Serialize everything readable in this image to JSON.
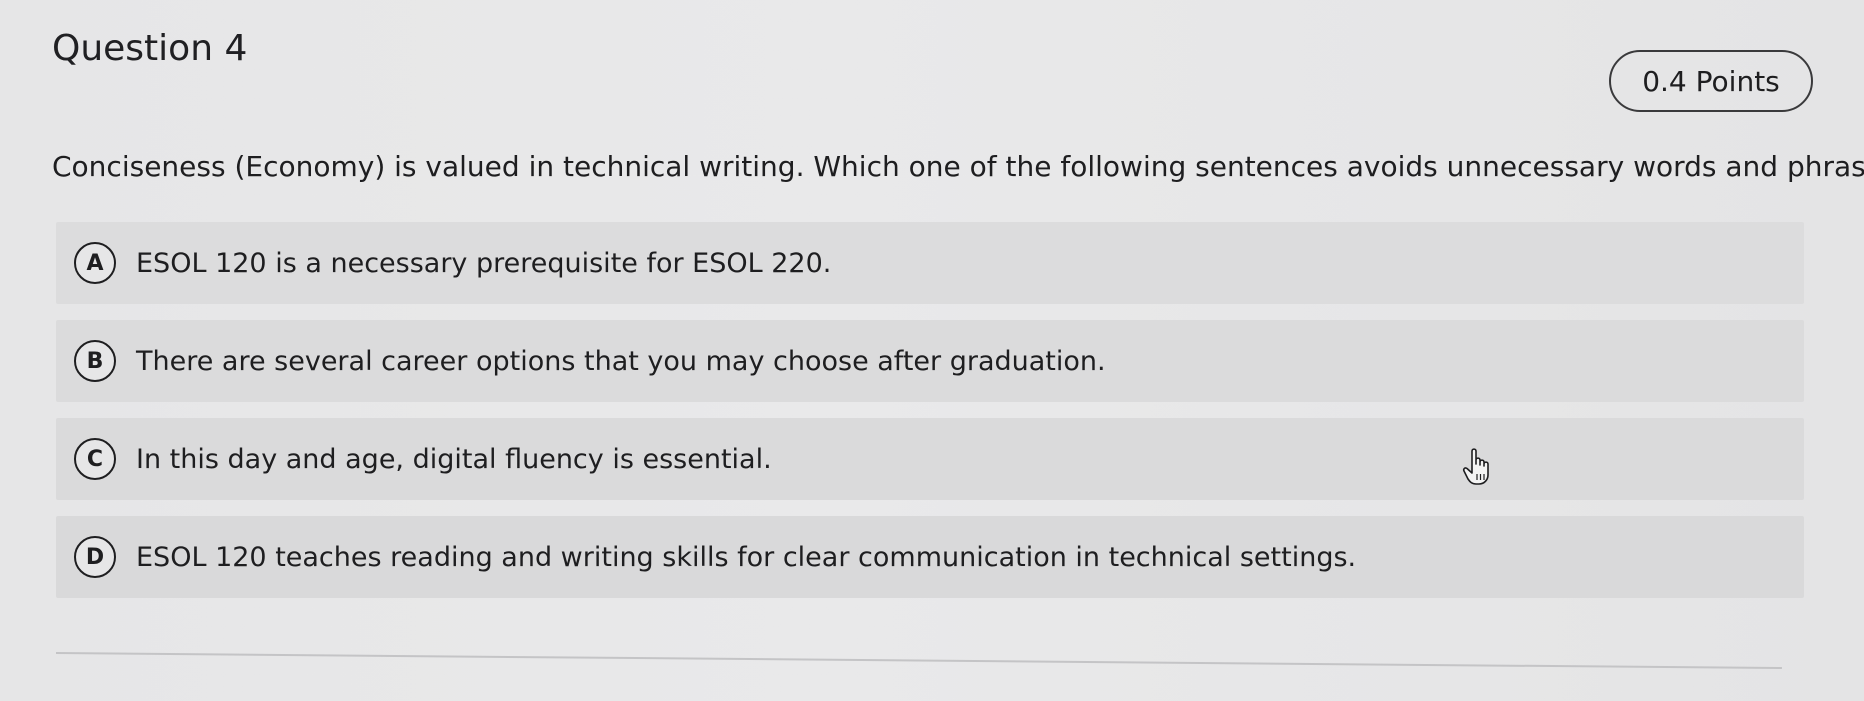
{
  "question": {
    "title": "Question 4",
    "points": "0.4 Points",
    "prompt": "Conciseness (Economy) is valued in technical writing. Which one of the following sentences avoids unnecessary words and phrases?"
  },
  "options": [
    {
      "letter": "A",
      "text": "ESOL 120 is a necessary prerequisite for ESOL 220."
    },
    {
      "letter": "B",
      "text": "There are several career options that you may choose after graduation."
    },
    {
      "letter": "C",
      "text": "In this day and age, digital fluency is essential."
    },
    {
      "letter": "D",
      "text": "ESOL 120 teaches reading and writing skills for clear communication in technical settings."
    }
  ],
  "icons": {
    "cursor": "hand-pointer-icon"
  }
}
